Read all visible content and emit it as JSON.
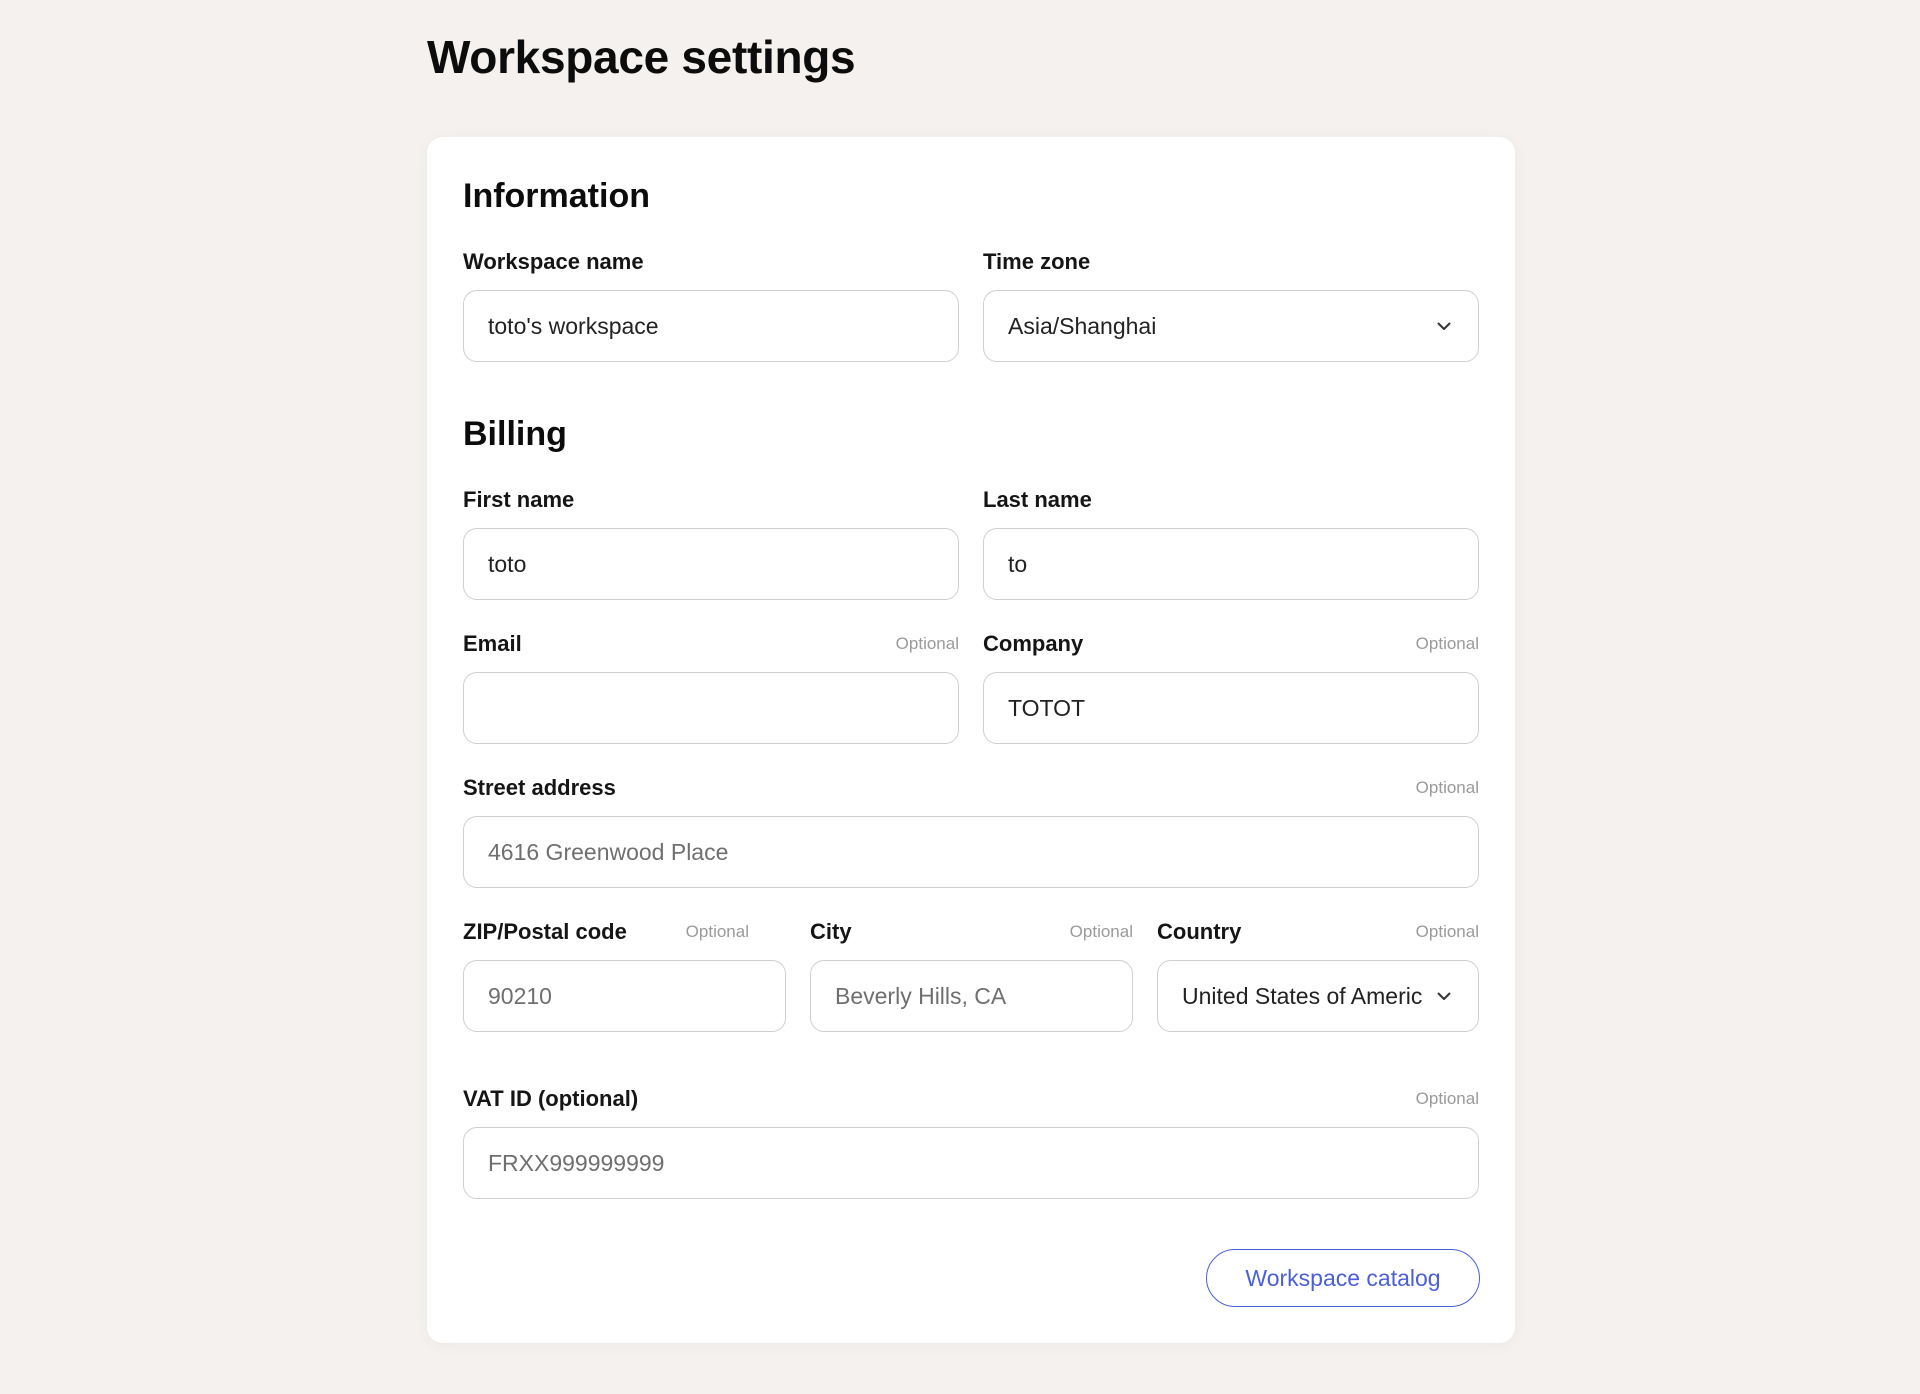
{
  "page": {
    "title": "Workspace settings"
  },
  "information": {
    "title": "Information",
    "workspace_name": {
      "label": "Workspace name",
      "value": "toto's workspace"
    },
    "time_zone": {
      "label": "Time zone",
      "value": "Asia/Shanghai"
    }
  },
  "billing": {
    "title": "Billing",
    "first_name": {
      "label": "First name",
      "value": "toto"
    },
    "last_name": {
      "label": "Last name",
      "value": "to"
    },
    "email": {
      "label": "Email",
      "optional": "Optional",
      "value": ""
    },
    "company": {
      "label": "Company",
      "optional": "Optional",
      "value": "TOTOT"
    },
    "street_address": {
      "label": "Street address",
      "optional": "Optional",
      "placeholder": "4616 Greenwood Place"
    },
    "zip": {
      "label": "ZIP/Postal code",
      "optional": "Optional",
      "placeholder": "90210"
    },
    "city": {
      "label": "City",
      "optional": "Optional",
      "placeholder": "Beverly Hills, CA"
    },
    "country": {
      "label": "Country",
      "optional": "Optional",
      "value": "United States of Americ"
    },
    "vat": {
      "label": "VAT ID (optional)",
      "optional": "Optional",
      "placeholder": "FRXX999999999"
    }
  },
  "actions": {
    "catalog_label": "Workspace catalog"
  },
  "icons": {
    "dropdown": "chevron-down-icon"
  },
  "colors": {
    "background": "#f4f1ee",
    "card": "#ffffff",
    "accent": "#4a5fd9",
    "border": "#cfcfcf",
    "muted": "#9a9a9a"
  }
}
